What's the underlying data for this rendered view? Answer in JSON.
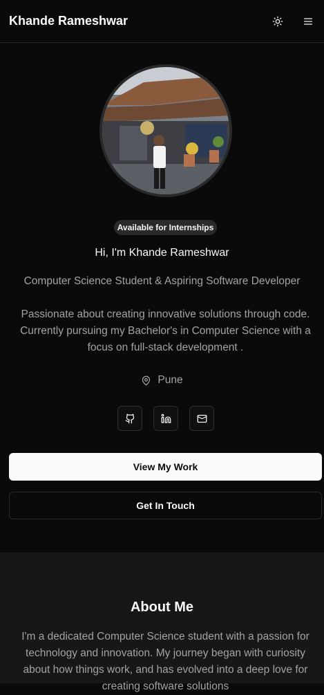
{
  "header": {
    "brand": "Khande Rameshwar",
    "theme_icon": "sun-icon",
    "menu_icon": "menu-icon"
  },
  "hero": {
    "badge": "Available for Internships",
    "greeting": "Hi, I'm Khande Rameshwar",
    "subtitle": "Computer Science Student & Aspiring Software Developer",
    "bio": "Passionate about creating innovative solutions through code. Currently pursuing my Bachelor's in Computer Science with a focus on full-stack development .",
    "location": "Pune",
    "location_icon": "map-pin-icon",
    "socials": [
      {
        "icon": "github-icon"
      },
      {
        "icon": "linkedin-icon"
      },
      {
        "icon": "mail-icon"
      }
    ],
    "primary_button": "View My Work",
    "secondary_button": "Get In Touch"
  },
  "about": {
    "title": "About Me",
    "text": "I'm a dedicated Computer Science student with a passion for technology and innovation. My journey began with curiosity about how things work, and has evolved into a deep love for creating software solutions"
  },
  "colors": {
    "background": "#0a0a0a",
    "section_alt": "#171717",
    "muted_text": "#a3a3a3",
    "primary_button_bg": "#fafafa"
  }
}
